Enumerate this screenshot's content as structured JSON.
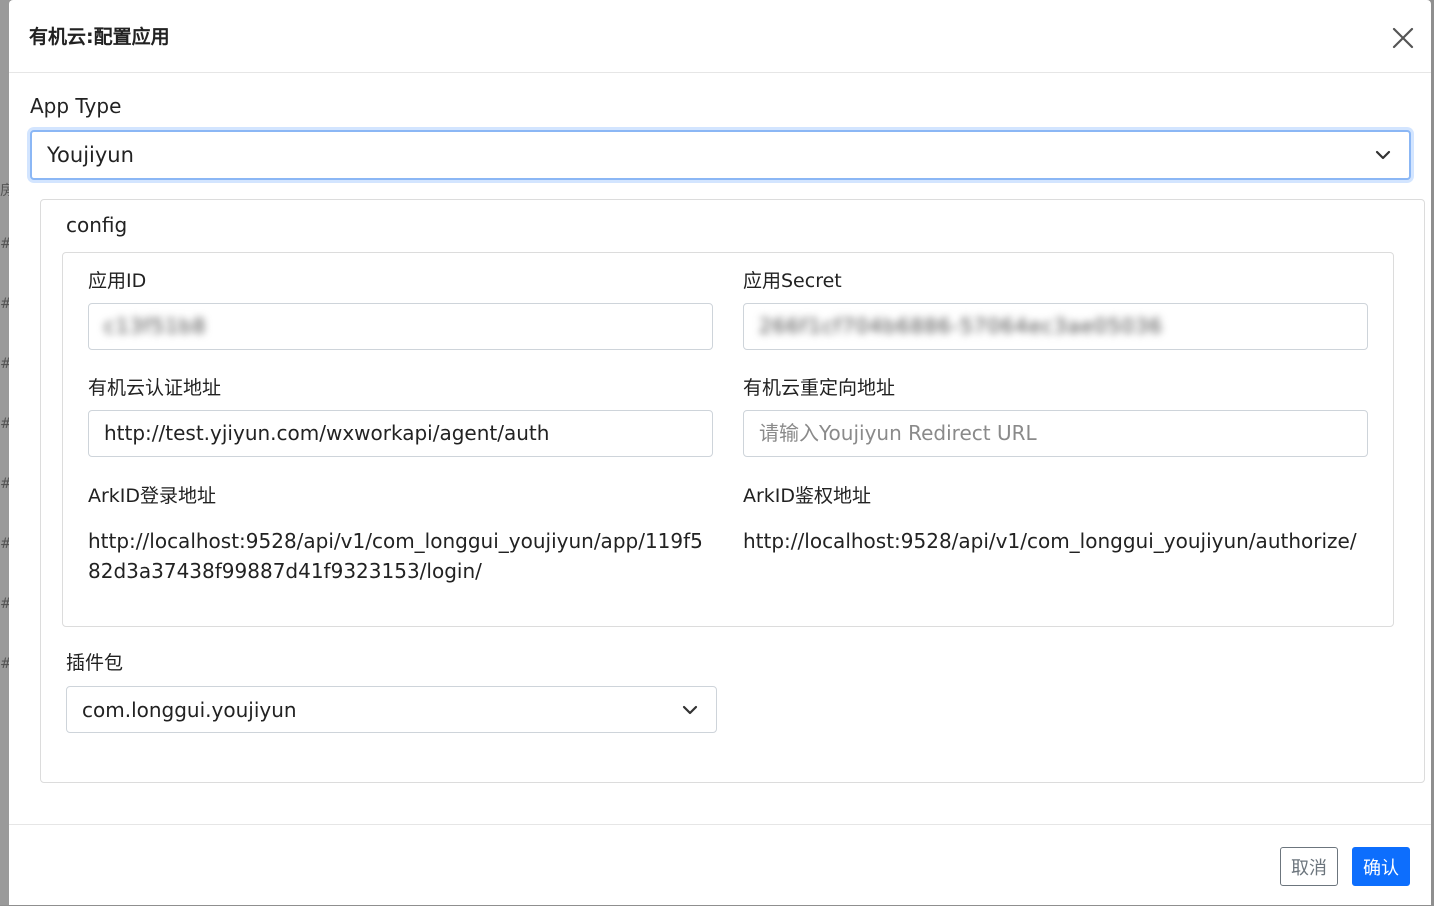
{
  "backdrop": {
    "marks": [
      "房",
      "#",
      "#",
      "#",
      "#",
      "#",
      "#",
      "#",
      "#"
    ]
  },
  "dialog": {
    "title": "有机云:配置应用",
    "close_icon": "close-icon"
  },
  "app_type": {
    "label": "App Type",
    "selected": "Youjiyun"
  },
  "config": {
    "title": "config",
    "app_id": {
      "label": "应用ID",
      "value": "c13f51b8"
    },
    "app_secret": {
      "label": "应用Secret",
      "value": "266f1cf704b6886-57064ec3ae05036"
    },
    "auth_url": {
      "label": "有机云认证地址",
      "value": "http://test.yjiyun.com/wxworkapi/agent/auth"
    },
    "redirect_url": {
      "label": "有机云重定向地址",
      "value": "",
      "placeholder": "请输入Youjiyun Redirect URL"
    },
    "login_url": {
      "label": "ArkID登录地址",
      "value": "http://localhost:9528/api/v1/com_longgui_youjiyun/app/119f582d3a37438f99887d41f9323153/login/"
    },
    "authorize_url": {
      "label": "ArkID鉴权地址",
      "value": "http://localhost:9528/api/v1/com_longgui_youjiyun/authorize/"
    }
  },
  "plugin": {
    "label": "插件包",
    "selected": "com.longgui.youjiyun"
  },
  "footer": {
    "cancel_label": "取消",
    "ok_label": "确认"
  },
  "colors": {
    "primary": "#0d6efd",
    "focus_border": "#8bb7f5",
    "secondary": "#6c757d"
  }
}
